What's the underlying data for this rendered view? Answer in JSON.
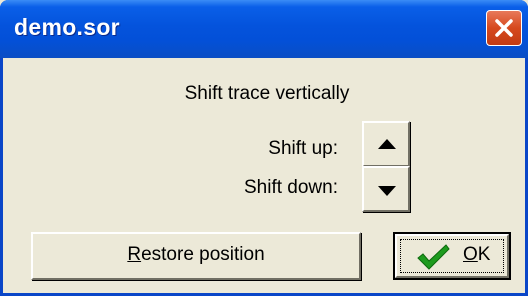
{
  "window": {
    "title": "demo.sor"
  },
  "dialog": {
    "heading": "Shift trace vertically",
    "shift_up_label": "Shift up:",
    "shift_down_label": "Shift down:",
    "restore_button": {
      "mnemonic": "R",
      "rest": "estore position"
    },
    "ok_button": {
      "mnemonic": "O",
      "rest": "K"
    }
  },
  "icons": {
    "close": "close-icon",
    "up": "triangle-up-icon",
    "down": "triangle-down-icon",
    "ok": "checkmark-icon"
  },
  "colors": {
    "titlebar": "#0453dc",
    "close_button": "#d6491e",
    "dialog_background": "#ece9d8",
    "checkmark": "#1e9b1e"
  }
}
